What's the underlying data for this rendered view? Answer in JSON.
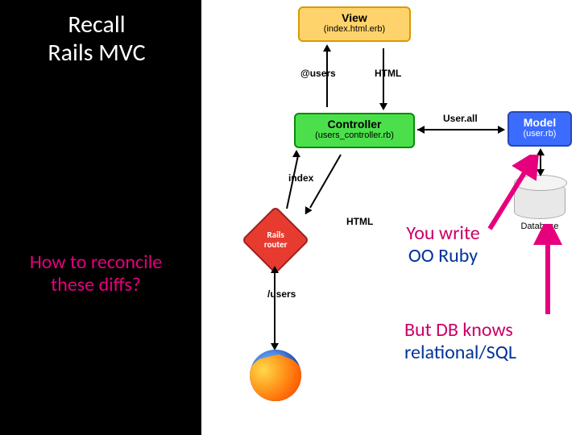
{
  "title": {
    "line1": "Recall",
    "line2": "Rails MVC"
  },
  "reconcile": {
    "line1": "How to reconcile",
    "line2": "these diffs?"
  },
  "oo_ruby": {
    "line1": "You write",
    "line2": "OO Ruby"
  },
  "db_rel": {
    "line1": "But DB knows",
    "line2": "relational/SQL"
  },
  "view": {
    "title": "View",
    "sub": "(index.html.erb)"
  },
  "controller": {
    "title": "Controller",
    "sub": "(users_controller.rb)"
  },
  "model": {
    "title": "Model",
    "sub": "(user.rb)"
  },
  "router": {
    "line1": "Rails",
    "line2": "router"
  },
  "database": {
    "label": "Database"
  },
  "labels": {
    "at_users": "@users",
    "html": "HTML",
    "index": "index",
    "slash_users": "/users",
    "user_all": "User.all"
  }
}
